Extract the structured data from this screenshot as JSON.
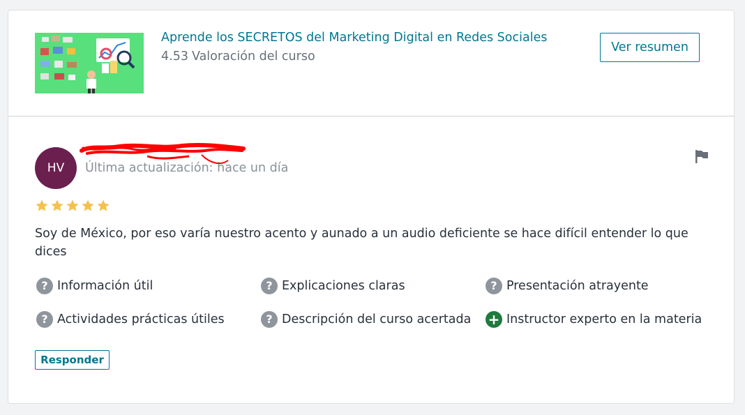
{
  "course": {
    "title": "Aprende los SECRETOS del Marketing Digital en Redes Sociales",
    "rating_value": "4.53",
    "rating_label": "Valoración del curso",
    "summary_button": "Ver resumen",
    "thumbnail_icon": "marketing-illustration"
  },
  "review": {
    "avatar_initials": "HV",
    "avatar_color": "#6a1f4f",
    "updated_text": "Última actualización: hace un día",
    "rating_stars": 5,
    "rating_max": 5,
    "comment": "Soy de México, por eso varía nuestro acento y aunado a un audio deficiente se hace difícil entender lo que dices",
    "criteria": [
      {
        "label": "Información útil",
        "icon": "question-icon"
      },
      {
        "label": "Explicaciones claras",
        "icon": "question-icon"
      },
      {
        "label": "Presentación atrayente",
        "icon": "question-icon"
      },
      {
        "label": "Actividades prácticas útiles",
        "icon": "question-icon"
      },
      {
        "label": "Descripción del curso acertada",
        "icon": "question-icon"
      },
      {
        "label": "Instructor experto en la materia",
        "icon": "plus-icon"
      }
    ],
    "reply_button": "Responder",
    "report_icon": "flag-icon"
  },
  "colors": {
    "link": "#007791",
    "star": "#f4c150",
    "question": "#8f959c",
    "positive": "#1f7a3e",
    "redaction": "#ff0000"
  }
}
